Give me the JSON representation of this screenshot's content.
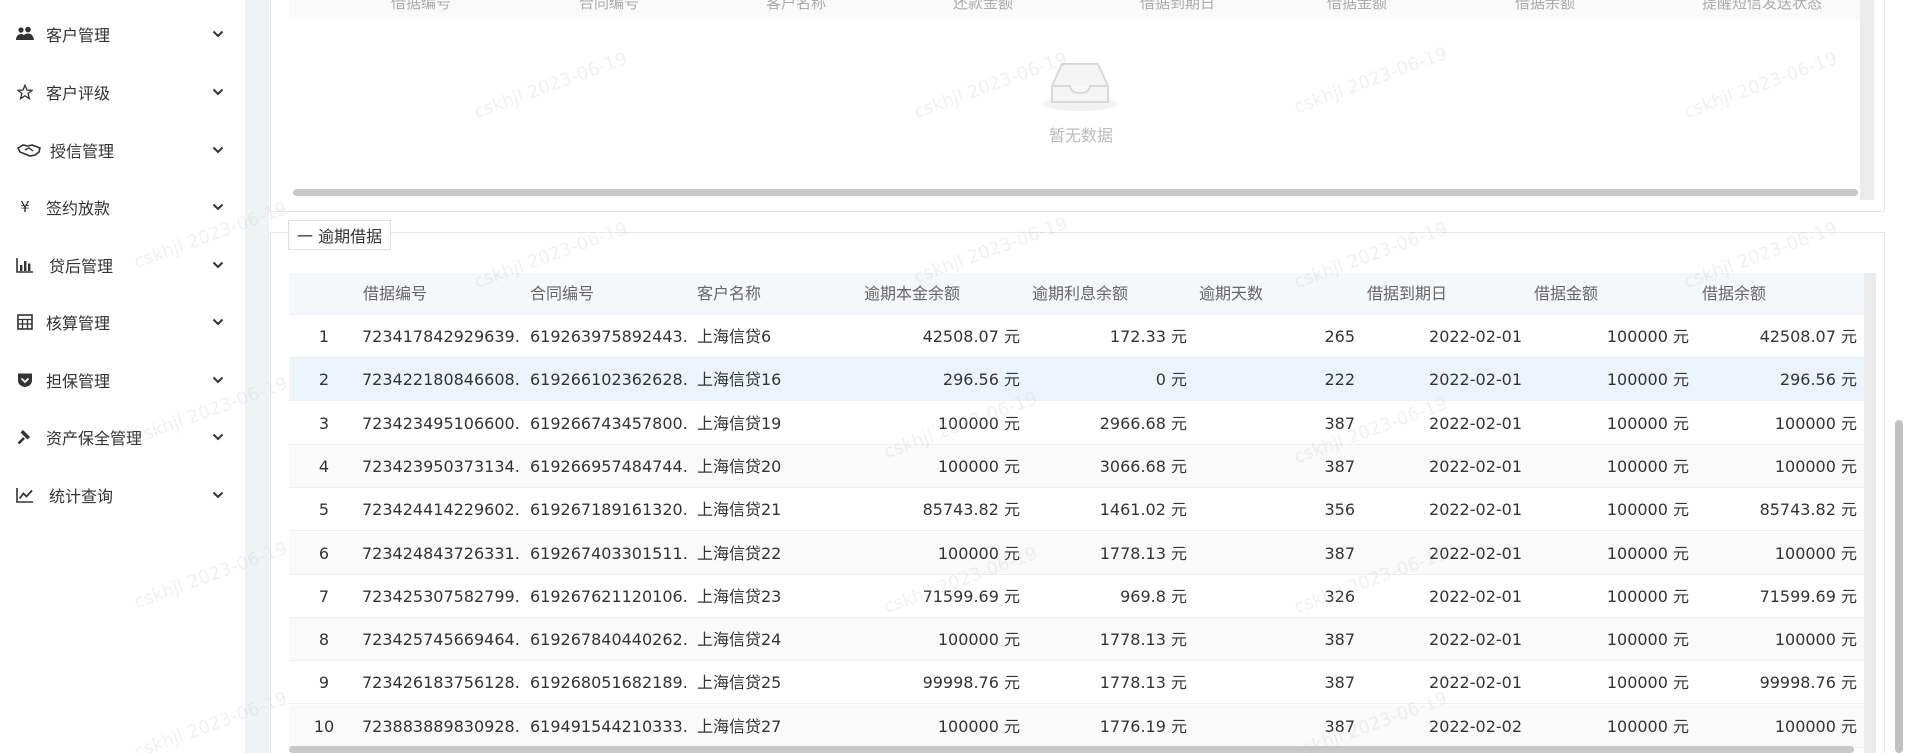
{
  "sidebar": {
    "items": [
      {
        "label": "客户管理",
        "icon": "users-icon"
      },
      {
        "label": "客户评级",
        "icon": "star-outline-icon"
      },
      {
        "label": "授信管理",
        "icon": "handshake-icon"
      },
      {
        "label": "签约放款",
        "icon": "yen-icon"
      },
      {
        "label": "贷后管理",
        "icon": "bar-chart-icon"
      },
      {
        "label": "核算管理",
        "icon": "calculator-icon"
      },
      {
        "label": "担保管理",
        "icon": "shield-icon"
      },
      {
        "label": "资产保全管理",
        "icon": "gavel-icon"
      },
      {
        "label": "统计查询",
        "icon": "line-chart-icon"
      }
    ]
  },
  "top_table": {
    "headers": [
      "借据编号",
      "合同编号",
      "客户名称",
      "还款金额",
      "借据到期日",
      "借据金额",
      "借据余额",
      "提醒短信发送状态"
    ],
    "empty_text": "暂无数据"
  },
  "overdue": {
    "legend_label": "一 逾期借据",
    "headers": [
      "借据编号",
      "合同编号",
      "客户名称",
      "逾期本金余额",
      "逾期利息余额",
      "逾期天数",
      "借据到期日",
      "借据金额",
      "借据余额"
    ],
    "rows": [
      {
        "index": "1",
        "loan_no": "723417842929639...",
        "contract_no": "619263975892443...",
        "customer": "上海信贷6",
        "overdue_principal": "42508.07 元",
        "overdue_interest": "172.33 元",
        "overdue_days": "265",
        "due_date": "2022-02-01",
        "loan_amount": "100000 元",
        "loan_balance": "42508.07 元"
      },
      {
        "index": "2",
        "loan_no": "723422180846608...",
        "contract_no": "619266102362628...",
        "customer": "上海信贷16",
        "overdue_principal": "296.56 元",
        "overdue_interest": "0 元",
        "overdue_days": "222",
        "due_date": "2022-02-01",
        "loan_amount": "100000 元",
        "loan_balance": "296.56 元"
      },
      {
        "index": "3",
        "loan_no": "723423495106600...",
        "contract_no": "619266743457800...",
        "customer": "上海信贷19",
        "overdue_principal": "100000 元",
        "overdue_interest": "2966.68 元",
        "overdue_days": "387",
        "due_date": "2022-02-01",
        "loan_amount": "100000 元",
        "loan_balance": "100000 元"
      },
      {
        "index": "4",
        "loan_no": "723423950373134...",
        "contract_no": "619266957484744...",
        "customer": "上海信贷20",
        "overdue_principal": "100000 元",
        "overdue_interest": "3066.68 元",
        "overdue_days": "387",
        "due_date": "2022-02-01",
        "loan_amount": "100000 元",
        "loan_balance": "100000 元"
      },
      {
        "index": "5",
        "loan_no": "723424414229602...",
        "contract_no": "619267189161320...",
        "customer": "上海信贷21",
        "overdue_principal": "85743.82 元",
        "overdue_interest": "1461.02 元",
        "overdue_days": "356",
        "due_date": "2022-02-01",
        "loan_amount": "100000 元",
        "loan_balance": "85743.82 元"
      },
      {
        "index": "6",
        "loan_no": "723424843726331...",
        "contract_no": "619267403301511...",
        "customer": "上海信贷22",
        "overdue_principal": "100000 元",
        "overdue_interest": "1778.13 元",
        "overdue_days": "387",
        "due_date": "2022-02-01",
        "loan_amount": "100000 元",
        "loan_balance": "100000 元"
      },
      {
        "index": "7",
        "loan_no": "723425307582799...",
        "contract_no": "619267621120106...",
        "customer": "上海信贷23",
        "overdue_principal": "71599.69 元",
        "overdue_interest": "969.8 元",
        "overdue_days": "326",
        "due_date": "2022-02-01",
        "loan_amount": "100000 元",
        "loan_balance": "71599.69 元"
      },
      {
        "index": "8",
        "loan_no": "723425745669464...",
        "contract_no": "619267840440262...",
        "customer": "上海信贷24",
        "overdue_principal": "100000 元",
        "overdue_interest": "1778.13 元",
        "overdue_days": "387",
        "due_date": "2022-02-01",
        "loan_amount": "100000 元",
        "loan_balance": "100000 元"
      },
      {
        "index": "9",
        "loan_no": "723426183756128...",
        "contract_no": "619268051682189...",
        "customer": "上海信贷25",
        "overdue_principal": "99998.76 元",
        "overdue_interest": "1778.13 元",
        "overdue_days": "387",
        "due_date": "2022-02-01",
        "loan_amount": "100000 元",
        "loan_balance": "99998.76 元"
      },
      {
        "index": "10",
        "loan_no": "723883889830928...",
        "contract_no": "619491544210333...",
        "customer": "上海信贷27",
        "overdue_principal": "100000 元",
        "overdue_interest": "1776.19 元",
        "overdue_days": "387",
        "due_date": "2022-02-02",
        "loan_amount": "100000 元",
        "loan_balance": "100000 元"
      }
    ]
  },
  "watermark": {
    "text": "cskhjl 2023-06-19"
  },
  "colors": {
    "row_highlight": "#ecf5ff",
    "header_bg": "#f5f7fa",
    "sidebar_bg": "#ffffff"
  }
}
